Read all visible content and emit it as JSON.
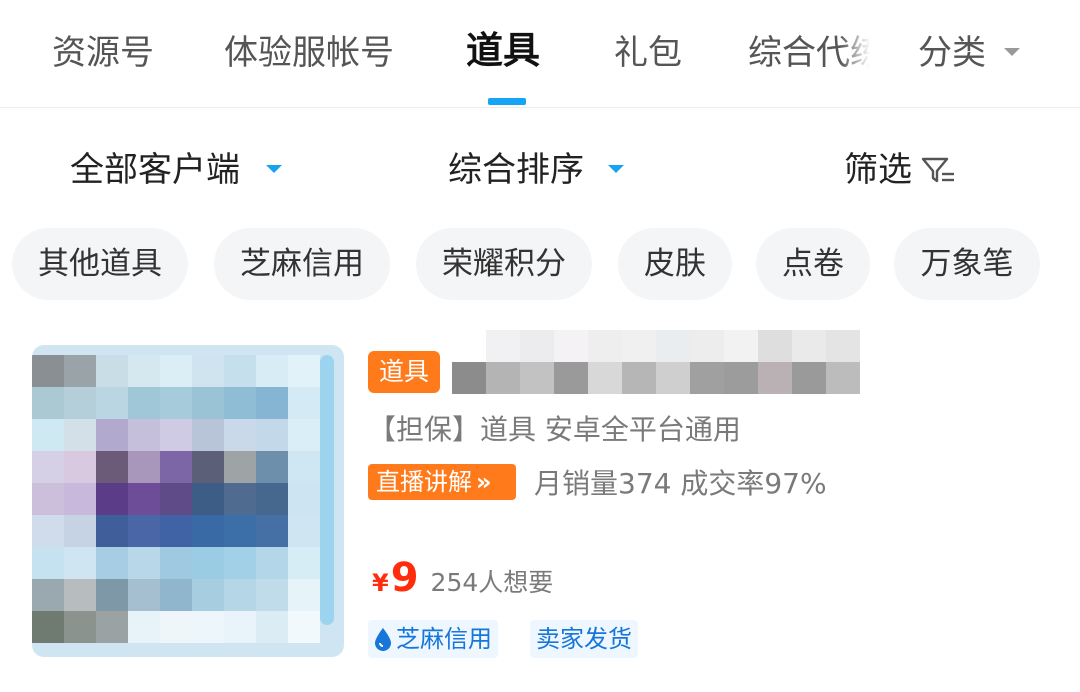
{
  "tabs": [
    {
      "label": "资源号",
      "active": false
    },
    {
      "label": "体验服帐号",
      "active": false
    },
    {
      "label": "道具",
      "active": true
    },
    {
      "label": "礼包",
      "active": false
    },
    {
      "label": "综合代练",
      "active": false
    }
  ],
  "category_label": "分类",
  "filters": {
    "client": "全部客户端",
    "sort": "综合排序",
    "screen": "筛选"
  },
  "chips": [
    "其他道具",
    "芝麻信用",
    "荣耀积分",
    "皮肤",
    "点卷",
    "万象笔"
  ],
  "product": {
    "tag": "道具",
    "subtitle": "【担保】道具  安卓全平台通用",
    "live_label": "直播讲解",
    "live_arrow": "»",
    "sales": "月销量374 成交率97%",
    "currency": "¥",
    "price": "9",
    "wants": "254人想要",
    "badges": [
      "芝麻信用",
      "卖家发货"
    ]
  },
  "colors": {
    "accent_blue": "#16a5f5",
    "tag_orange": "#ff7a1a",
    "price_red": "#ff2d0c",
    "badge_blue": "#1677d8"
  },
  "icons": {
    "category_arrow": "chevron-down-icon",
    "filter": "funnel-icon",
    "zhima": "water-drop-icon"
  }
}
